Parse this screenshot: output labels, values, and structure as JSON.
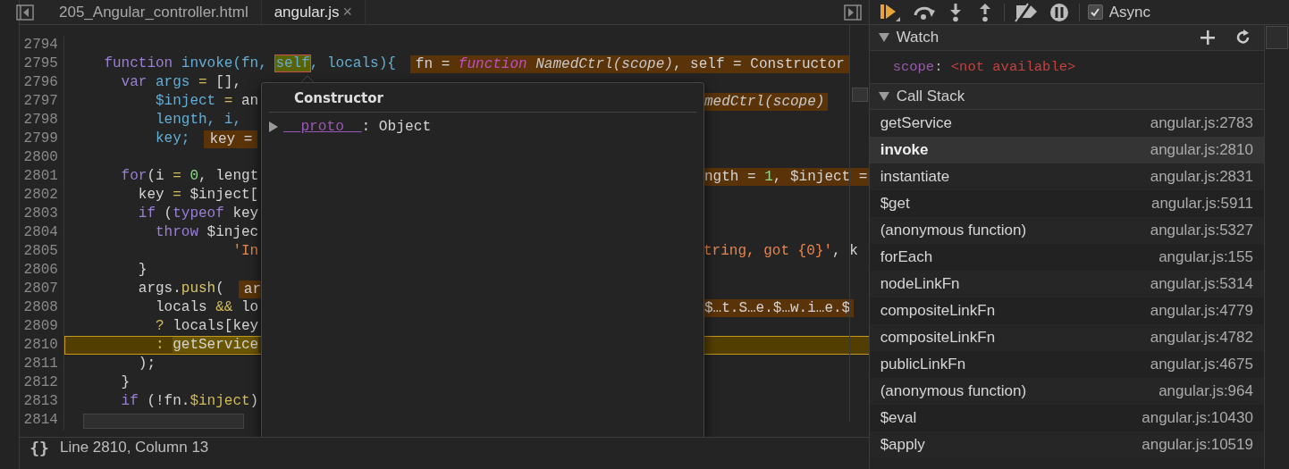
{
  "tabs": [
    {
      "label": "205_Angular_controller.html",
      "selected": false
    },
    {
      "label": "angular.js",
      "selected": true,
      "close": "×"
    }
  ],
  "code": [
    {
      "num": "2794",
      "current": false
    },
    {
      "num": "2795",
      "current": false,
      "left": [
        {
          "kind": "kw",
          "text": "    function"
        },
        {
          "kind": "name",
          "text": " invoke(fn, "
        },
        {
          "kind": "hovered",
          "text": "self"
        },
        {
          "kind": "name",
          "text": ", locals){"
        },
        {
          "kind": "value",
          "parts": [
            {
              "kind": "plain",
              "text": "fn = "
            },
            {
              "kind": "fnkw",
              "text": "function"
            },
            {
              "kind": "italic",
              "text": " NamedCtrl(scope)"
            },
            {
              "kind": "plain",
              "text": ", self = Constructor"
            }
          ]
        }
      ]
    },
    {
      "num": "2796",
      "current": false,
      "left": [
        {
          "kind": "kw",
          "text": "      var"
        },
        {
          "kind": "name",
          "text": " args"
        },
        {
          "kind": "op",
          "text": " ="
        },
        {
          "kind": "plain",
          "text": " [],"
        }
      ]
    },
    {
      "num": "2797",
      "current": false,
      "left": [
        {
          "kind": "name",
          "text": "          $inject"
        },
        {
          "kind": "op",
          "text": " ="
        },
        {
          "kind": "plain",
          "text": " an"
        }
      ],
      "right": [
        {
          "kind": "value",
          "parts": [
            {
              "kind": "italic",
              "text": "medCtrl(scope)"
            }
          ]
        }
      ]
    },
    {
      "num": "2798",
      "current": false,
      "left": [
        {
          "kind": "name",
          "text": "          length, i,"
        }
      ]
    },
    {
      "num": "2799",
      "current": false,
      "left": [
        {
          "kind": "name",
          "text": "          key;"
        },
        {
          "kind": "value",
          "parts": [
            {
              "kind": "plain",
              "text": "key ="
            }
          ]
        }
      ]
    },
    {
      "num": "2800",
      "current": false
    },
    {
      "num": "2801",
      "current": false,
      "left": [
        {
          "kind": "kw",
          "text": "      for"
        },
        {
          "kind": "plain",
          "text": "(i "
        },
        {
          "kind": "op",
          "text": "="
        },
        {
          "kind": "num",
          "text": " 0"
        },
        {
          "kind": "plain",
          "text": ", lengt"
        }
      ],
      "right": [
        {
          "kind": "value",
          "parts": [
            {
              "kind": "plain",
              "text": "ngth = "
            },
            {
              "kind": "num",
              "text": "1"
            },
            {
              "kind": "plain",
              "text": ", $inject ="
            }
          ]
        }
      ]
    },
    {
      "num": "2802",
      "current": false,
      "left": [
        {
          "kind": "plain",
          "text": "        key "
        },
        {
          "kind": "op",
          "text": "="
        },
        {
          "kind": "plain",
          "text": " $inject["
        }
      ]
    },
    {
      "num": "2803",
      "current": false,
      "left": [
        {
          "kind": "kw",
          "text": "        if"
        },
        {
          "kind": "plain",
          "text": " ("
        },
        {
          "kind": "kw",
          "text": "typeof"
        },
        {
          "kind": "plain",
          "text": " key"
        }
      ]
    },
    {
      "num": "2804",
      "current": false,
      "left": [
        {
          "kind": "kw",
          "text": "          throw"
        },
        {
          "kind": "plain",
          "text": " $injec"
        }
      ]
    },
    {
      "num": "2805",
      "current": false,
      "left": [
        {
          "kind": "str",
          "text": "                   'In"
        }
      ],
      "right": [
        {
          "kind": "str",
          "text": "tring, got {0}'"
        },
        {
          "kind": "plain",
          "text": ", k"
        }
      ]
    },
    {
      "num": "2806",
      "current": false,
      "left": [
        {
          "kind": "plain",
          "text": "        }"
        }
      ]
    },
    {
      "num": "2807",
      "current": false,
      "left": [
        {
          "kind": "plain",
          "text": "        args."
        },
        {
          "kind": "fn",
          "text": "push"
        },
        {
          "kind": "plain",
          "text": "("
        },
        {
          "kind": "value",
          "parts": [
            {
              "kind": "plain",
              "text": "ar"
            }
          ]
        }
      ]
    },
    {
      "num": "2808",
      "current": false,
      "left": [
        {
          "kind": "plain",
          "text": "          locals "
        },
        {
          "kind": "op",
          "text": "&&"
        },
        {
          "kind": "plain",
          "text": " lo"
        }
      ],
      "right": [
        {
          "kind": "value",
          "parts": [
            {
              "kind": "plain",
              "text": "$…t.S…e.$…w.i…e.$"
            }
          ]
        }
      ]
    },
    {
      "num": "2809",
      "current": false,
      "left": [
        {
          "kind": "op",
          "text": "          ?"
        },
        {
          "kind": "plain",
          "text": " locals[key"
        }
      ]
    },
    {
      "num": "2810",
      "current": true,
      "left": [
        {
          "kind": "op",
          "text": "          : "
        },
        {
          "kind": "exec",
          "text": "getService"
        }
      ]
    },
    {
      "num": "2811",
      "current": false,
      "left": [
        {
          "kind": "plain",
          "text": "        );"
        }
      ]
    },
    {
      "num": "2812",
      "current": false,
      "left": [
        {
          "kind": "plain",
          "text": "      }"
        }
      ]
    },
    {
      "num": "2813",
      "current": false,
      "left": [
        {
          "kind": "kw",
          "text": "      if"
        },
        {
          "kind": "plain",
          "text": " (!fn."
        },
        {
          "kind": "op",
          "text": "$inject"
        },
        {
          "kind": "plain",
          "text": ")"
        }
      ]
    },
    {
      "num": "2814",
      "current": false
    }
  ],
  "popover": {
    "title": "Constructor",
    "properties": [
      {
        "name": "__proto__",
        "separator": ":",
        "value": "Object",
        "expanded": false
      }
    ]
  },
  "status_bar": {
    "format_button": "{}",
    "position": "Line 2810, Column 13"
  },
  "toolbar": {
    "buttons": [
      {
        "kind": "resume"
      },
      {
        "kind": "step-over"
      },
      {
        "kind": "step-into"
      },
      {
        "kind": "step-out"
      },
      {
        "kind": "separator"
      },
      {
        "kind": "deactivate"
      },
      {
        "kind": "pause-exceptions"
      },
      {
        "kind": "separator"
      }
    ],
    "async": {
      "label": "Async",
      "checked": true
    }
  },
  "watch": {
    "title": "Watch",
    "expanded": true,
    "items": [
      {
        "name": "scope",
        "separator": ":",
        "value": "<not available>"
      }
    ]
  },
  "call_stack": {
    "title": "Call Stack",
    "expanded": true,
    "frames": [
      {
        "name": "getService",
        "location": "angular.js:2783",
        "selected": false
      },
      {
        "name": "invoke",
        "location": "angular.js:2810",
        "selected": true
      },
      {
        "name": "instantiate",
        "location": "angular.js:2831",
        "selected": false
      },
      {
        "name": "$get",
        "location": "angular.js:5911",
        "selected": false
      },
      {
        "name": "(anonymous function)",
        "location": "angular.js:5327",
        "selected": false
      },
      {
        "name": "forEach",
        "location": "angular.js:155",
        "selected": false
      },
      {
        "name": "nodeLinkFn",
        "location": "angular.js:5314",
        "selected": false
      },
      {
        "name": "compositeLinkFn",
        "location": "angular.js:4779",
        "selected": false
      },
      {
        "name": "compositeLinkFn",
        "location": "angular.js:4782",
        "selected": false
      },
      {
        "name": "publicLinkFn",
        "location": "angular.js:4675",
        "selected": false
      },
      {
        "name": "(anonymous function)",
        "location": "angular.js:964",
        "selected": false
      },
      {
        "name": "$eval",
        "location": "angular.js:10430",
        "selected": false
      },
      {
        "name": "$apply",
        "location": "angular.js:10519",
        "selected": false
      }
    ]
  }
}
